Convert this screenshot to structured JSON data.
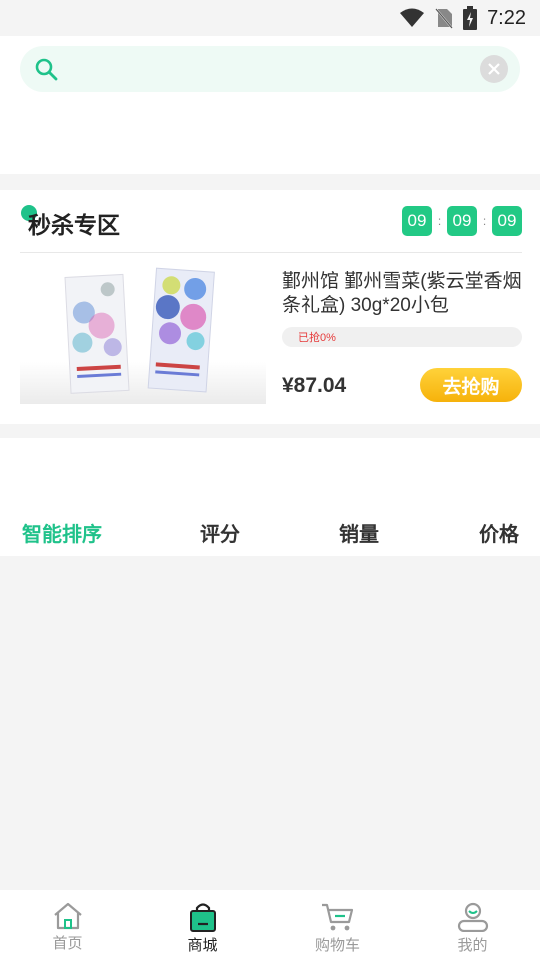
{
  "status_bar": {
    "time": "7:22"
  },
  "search": {
    "placeholder": ""
  },
  "flash_sale": {
    "title": "秒杀专区",
    "countdown": [
      "09",
      "09",
      "09"
    ],
    "product": {
      "name": "鄞州馆 鄞州雪菜(紫云堂香烟条礼盒) 30g*20小包",
      "progress_label": "已抢0%",
      "progress": 0,
      "price": "¥87.04",
      "buy_label": "去抢购"
    }
  },
  "sort": {
    "items": [
      "智能排序",
      "评分",
      "销量",
      "价格"
    ],
    "active_color": "#1fc28a"
  },
  "tabbar": {
    "items": [
      {
        "label": "首页",
        "icon": "home-icon"
      },
      {
        "label": "商城",
        "icon": "shopping-bag-icon"
      },
      {
        "label": "购物车",
        "icon": "cart-icon"
      },
      {
        "label": "我的",
        "icon": "user-icon"
      }
    ],
    "active_index": 1
  }
}
